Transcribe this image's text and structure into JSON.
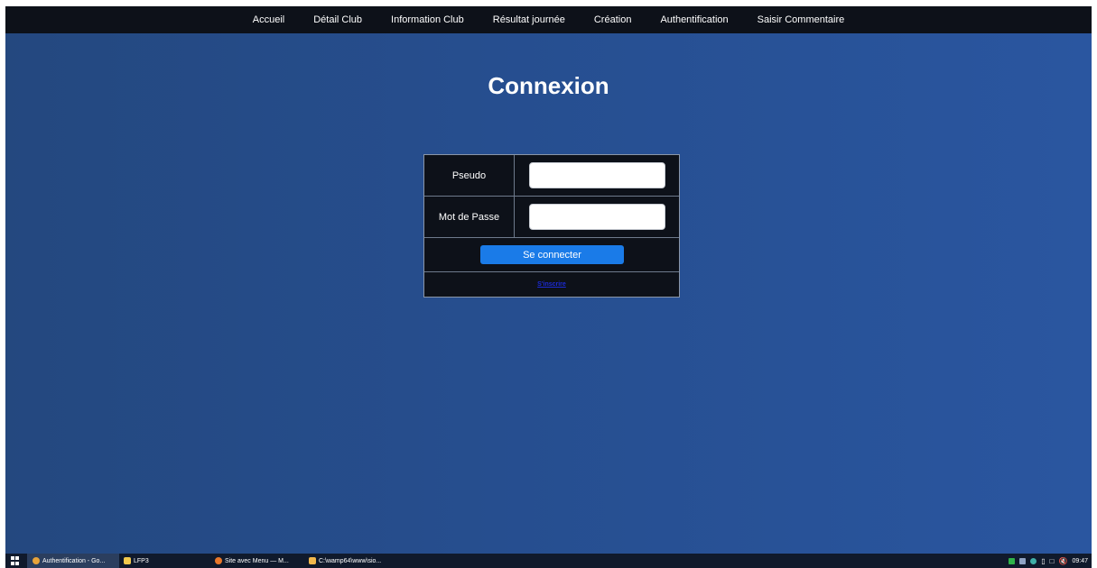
{
  "nav": {
    "items": [
      {
        "label": "Accueil"
      },
      {
        "label": "Détail Club"
      },
      {
        "label": "Information Club"
      },
      {
        "label": "Résultat journée"
      },
      {
        "label": "Création"
      },
      {
        "label": "Authentification"
      },
      {
        "label": "Saisir Commentaire"
      }
    ]
  },
  "page": {
    "title": "Connexion"
  },
  "form": {
    "pseudo_label": "Pseudo",
    "pseudo_value": "",
    "password_label": "Mot de Passe",
    "password_value": "",
    "submit_label": "Se connecter",
    "register_link": "S'inscrire"
  },
  "taskbar": {
    "tasks": [
      {
        "label": "Authentification - Go...",
        "icon": "chrome-icon"
      },
      {
        "label": "LFP3",
        "icon": "folder-icon"
      },
      {
        "label": "Site avec Menu — M...",
        "icon": "firefox-icon"
      },
      {
        "label": "C:\\wamp64\\www\\sio...",
        "icon": "file-explorer-icon"
      }
    ],
    "clock": "09:47"
  },
  "colors": {
    "navbar": "#0d1119",
    "background": "#264e8f",
    "button": "#1a7be8",
    "link": "#1c2bd6",
    "table": "#0d1119"
  }
}
